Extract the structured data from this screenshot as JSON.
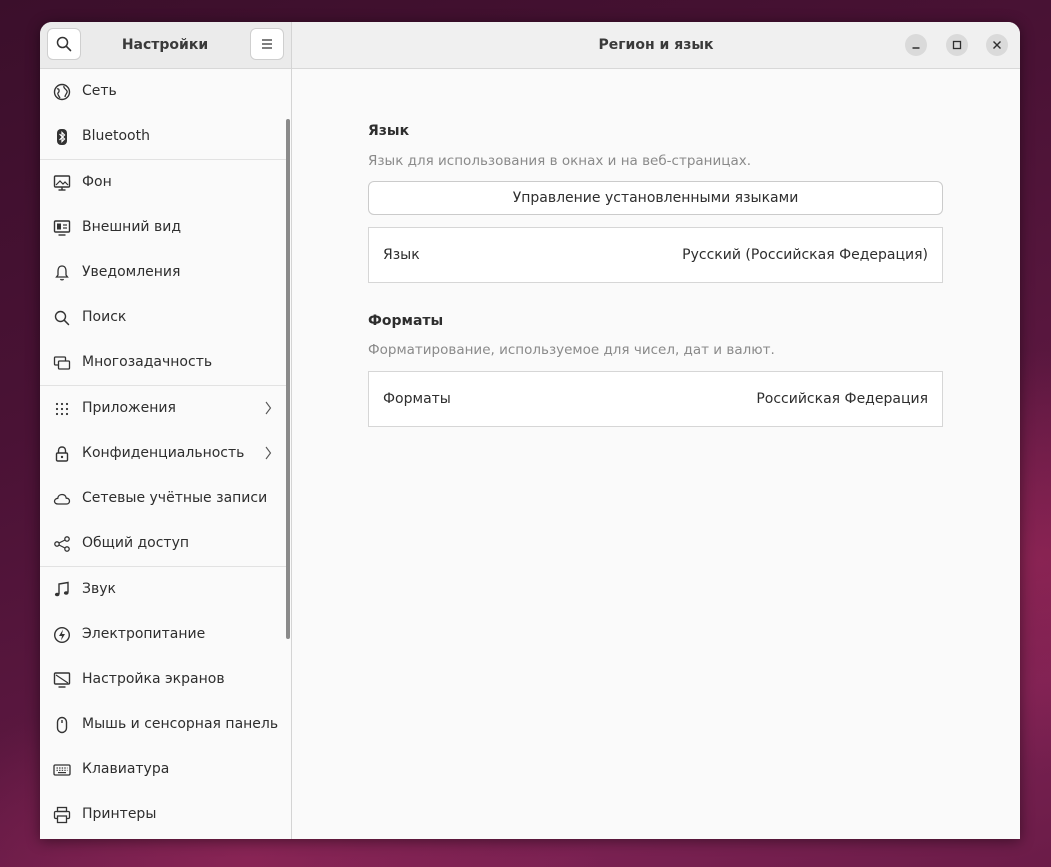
{
  "window": {
    "sidebar_title": "Настройки",
    "page_title": "Регион и язык",
    "icons": {
      "search": "search-icon",
      "menu": "hamburger-menu-icon",
      "minimize": "minimize-icon",
      "maximize": "maximize-icon",
      "close": "close-icon"
    }
  },
  "sidebar": {
    "items": [
      {
        "label": "Сеть",
        "icon": "network-icon"
      },
      {
        "label": "Bluetooth",
        "icon": "bluetooth-icon"
      },
      {
        "label": "Фон",
        "icon": "background-icon"
      },
      {
        "label": "Внешний вид",
        "icon": "appearance-icon"
      },
      {
        "label": "Уведомления",
        "icon": "bell-icon"
      },
      {
        "label": "Поиск",
        "icon": "search-icon"
      },
      {
        "label": "Многозадачность",
        "icon": "multitasking-icon"
      },
      {
        "label": "Приложения",
        "icon": "apps-grid-icon",
        "has_submenu": true
      },
      {
        "label": "Конфиденциальность",
        "icon": "lock-icon",
        "has_submenu": true
      },
      {
        "label": "Сетевые учётные записи",
        "icon": "cloud-icon"
      },
      {
        "label": "Общий доступ",
        "icon": "share-icon"
      },
      {
        "label": "Звук",
        "icon": "music-note-icon"
      },
      {
        "label": "Электропитание",
        "icon": "power-icon"
      },
      {
        "label": "Настройка экранов",
        "icon": "display-icon"
      },
      {
        "label": "Мышь и сенсорная панель",
        "icon": "mouse-icon"
      },
      {
        "label": "Клавиатура",
        "icon": "keyboard-icon"
      },
      {
        "label": "Принтеры",
        "icon": "printer-icon"
      }
    ]
  },
  "main": {
    "language": {
      "title": "Язык",
      "subtitle": "Язык для использования в окнах и на веб-страницах.",
      "manage_button": "Управление установленными языками",
      "row_label": "Язык",
      "row_value": "Русский (Российская Федерация)"
    },
    "formats": {
      "title": "Форматы",
      "subtitle": "Форматирование, используемое для чисел, дат и валют.",
      "row_label": "Форматы",
      "row_value": "Российская Федерация"
    }
  },
  "colors": {
    "window_bg": "#fafafa",
    "header_bg": "#ebebeb",
    "desktop_accent": "#7a2152"
  }
}
